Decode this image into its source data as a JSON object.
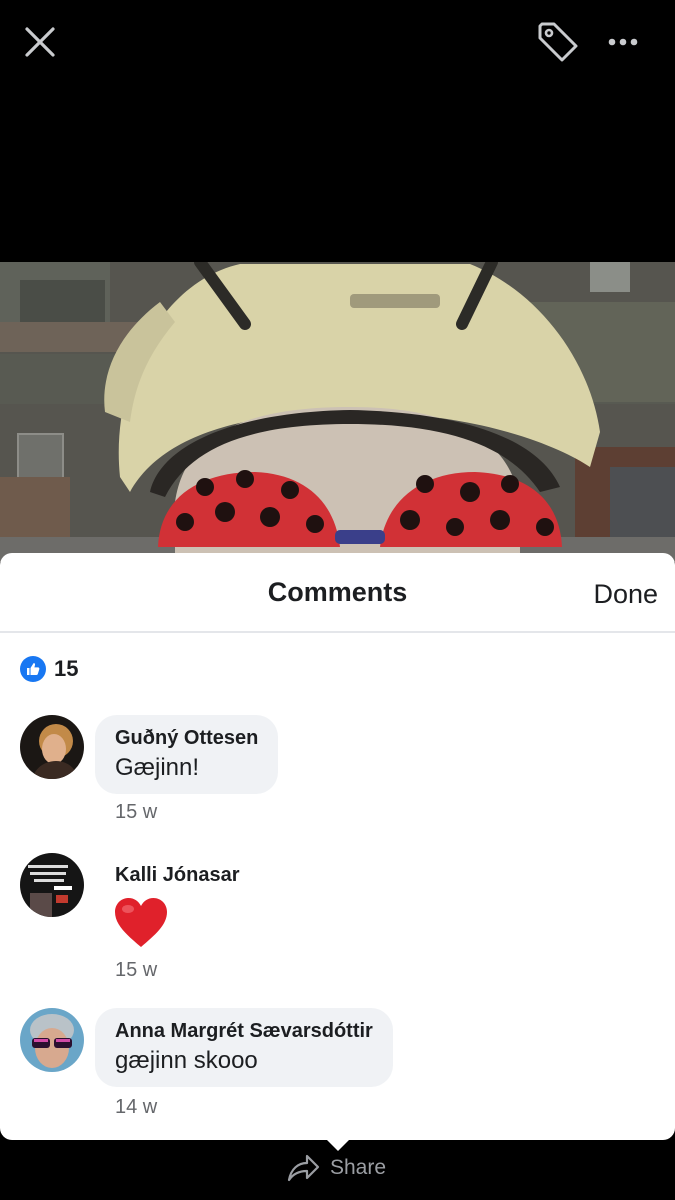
{
  "topbar": {
    "close_icon": "close-icon",
    "tag_icon": "tag-icon",
    "more_icon": "more-icon"
  },
  "comments_panel": {
    "title": "Comments",
    "done_label": "Done",
    "reactions": {
      "icon": "like-icon",
      "count": "15",
      "color": "#1877f2"
    },
    "comments": [
      {
        "author": "Guðný Ottesen",
        "text": "Gæjinn!",
        "time": "15 w"
      },
      {
        "author": "Kalli Jónasar",
        "text": "❤️",
        "time": "15 w"
      },
      {
        "author": "Anna Margrét Sævarsdóttir",
        "text": "gæjinn skooo",
        "time": "14 w"
      }
    ]
  },
  "footer": {
    "share_label": "Share",
    "share_icon": "share-arrow-icon"
  }
}
